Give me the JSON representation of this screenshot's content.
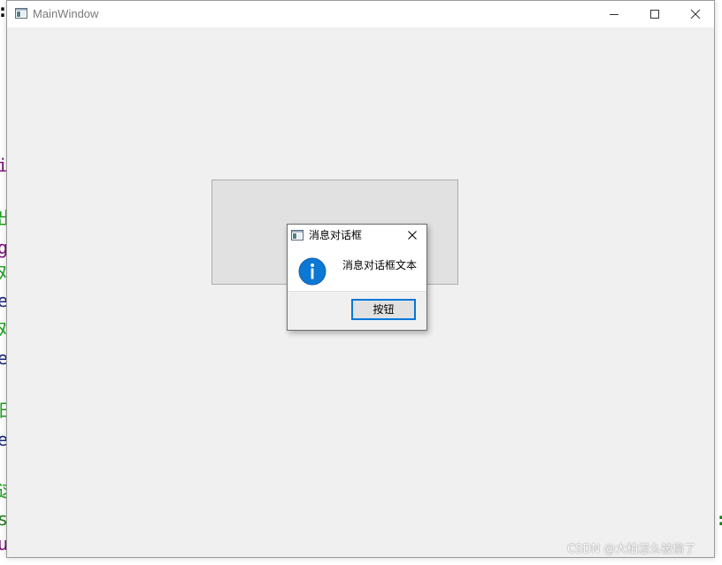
{
  "main_window": {
    "title": "MainWindow",
    "controls": {
      "minimize": "minimize-icon",
      "maximize": "maximize-icon",
      "close": "close-icon"
    }
  },
  "message_box": {
    "title": "消息对话框",
    "text": "消息对话框文本",
    "icon": "information-icon",
    "button_label": "按钮"
  },
  "background_code": {
    "left_fragments": [
      ":",
      "i",
      "出",
      "g",
      "对",
      "e",
      "对",
      "e",
      "日",
      "e",
      "这",
      "s",
      "u"
    ],
    "right_fragments": [
      ":"
    ]
  },
  "watermark": "CSDN @大柏怎么被偷了",
  "colors": {
    "window_bg": "#f0f0f0",
    "titlebar_bg": "#ffffff",
    "accent": "#0078d7",
    "frame_bg": "#e1e1e1",
    "info_icon": "#0078d7"
  }
}
